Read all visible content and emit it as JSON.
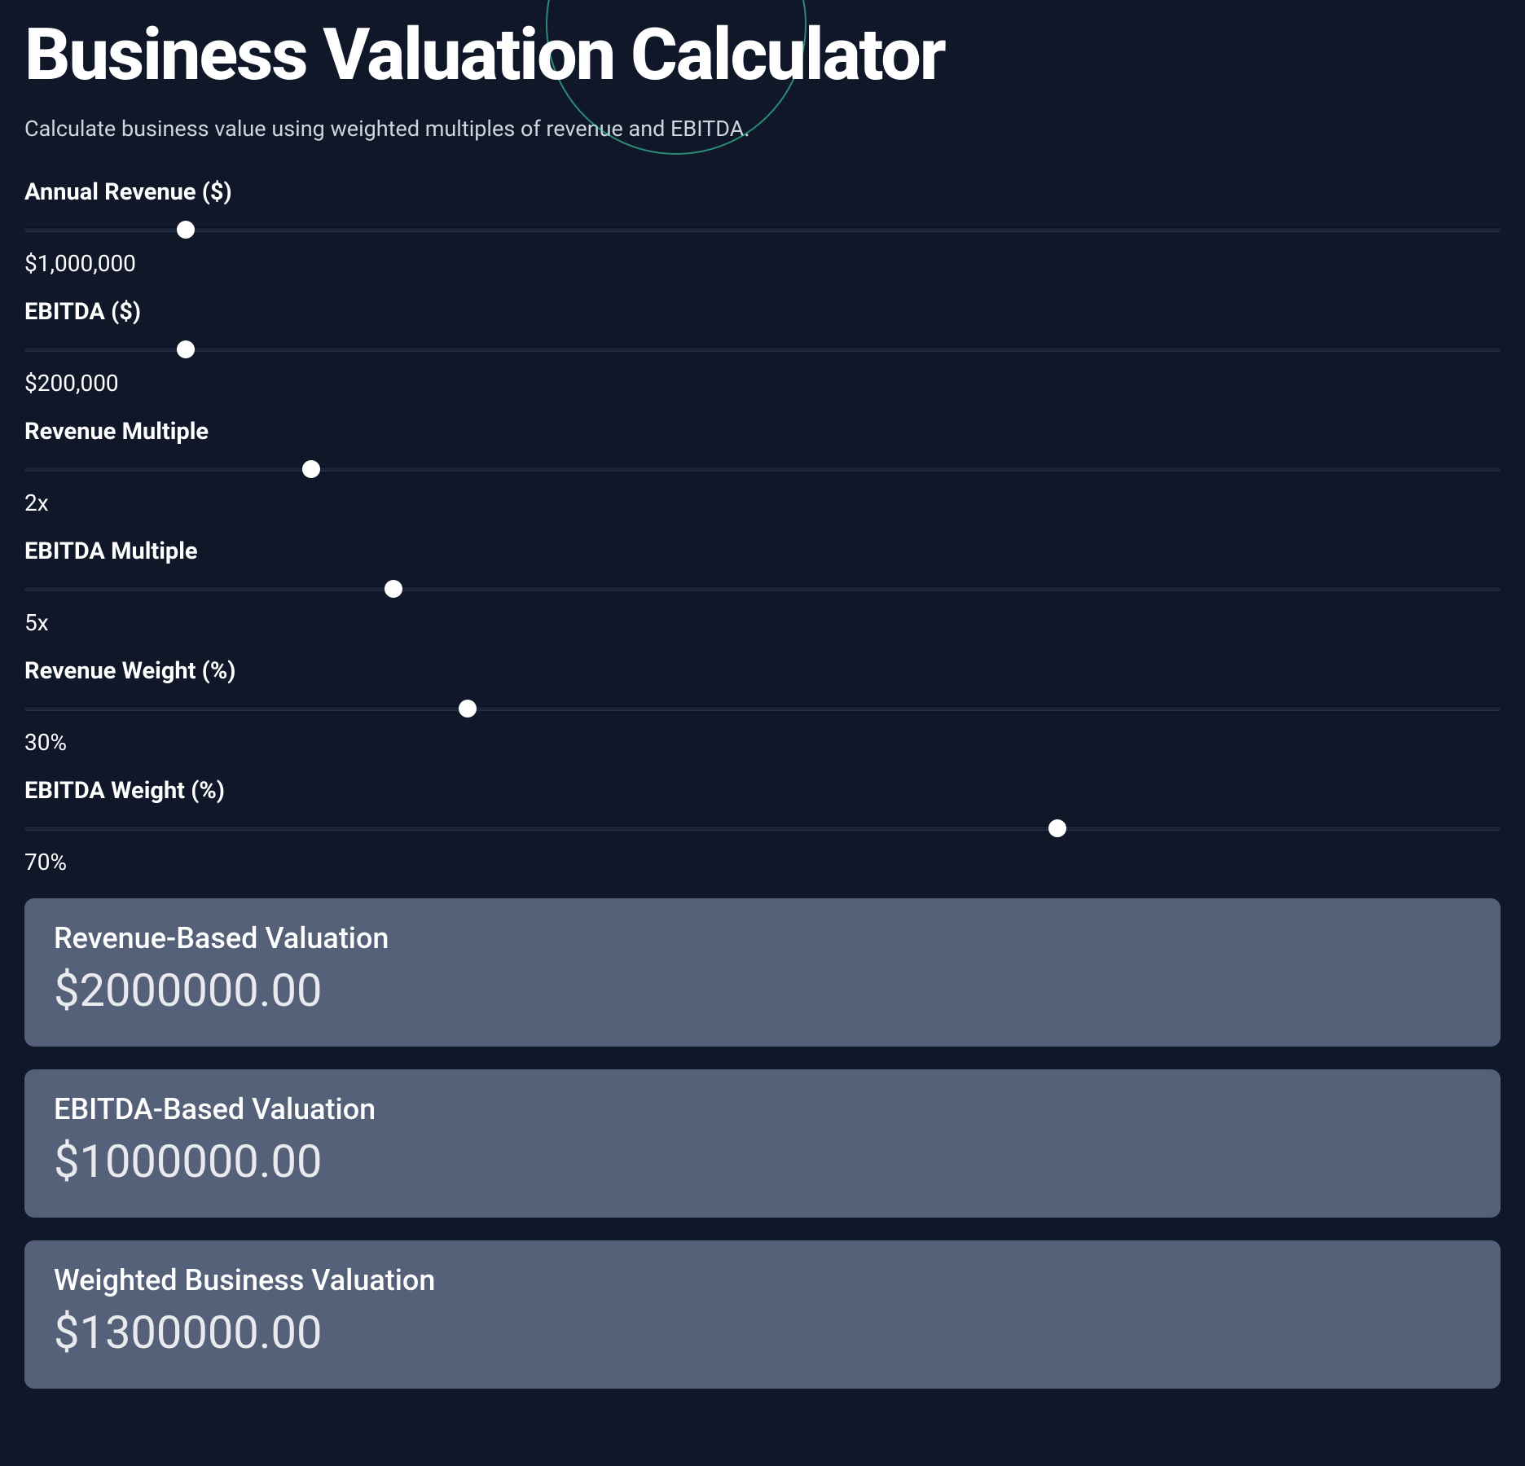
{
  "page": {
    "title": "Business Valuation Calculator",
    "description": "Calculate business value using weighted multiples of revenue and EBITDA."
  },
  "sliders": {
    "revenue": {
      "label": "Annual Revenue ($)",
      "displayValue": "$1,000,000",
      "percent": 10.9
    },
    "ebitda": {
      "label": "EBITDA ($)",
      "displayValue": "$200,000",
      "percent": 10.9
    },
    "revenueMultiple": {
      "label": "Revenue Multiple",
      "displayValue": "2x",
      "percent": 19.4
    },
    "ebitdaMultiple": {
      "label": "EBITDA Multiple",
      "displayValue": "5x",
      "percent": 25.0
    },
    "revenueWeight": {
      "label": "Revenue Weight (%)",
      "displayValue": "30%",
      "percent": 30.0
    },
    "ebitdaWeight": {
      "label": "EBITDA Weight (%)",
      "displayValue": "70%",
      "percent": 70.0
    }
  },
  "results": {
    "revenueBased": {
      "label": "Revenue-Based Valuation",
      "value": "$2000000.00"
    },
    "ebitdaBased": {
      "label": "EBITDA-Based Valuation",
      "value": "$1000000.00"
    },
    "weighted": {
      "label": "Weighted Business Valuation",
      "value": "$1300000.00"
    }
  }
}
